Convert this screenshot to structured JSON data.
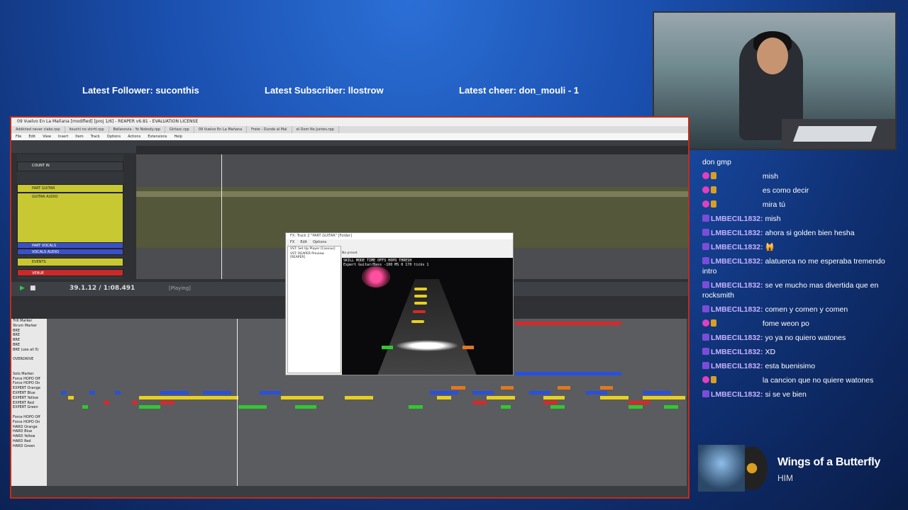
{
  "overlay": {
    "latest_follower": "Latest Follower: suconthis",
    "latest_subscriber": "Latest Subscriber: llostrow",
    "latest_cheer": "Latest cheer: don_mouli - 1"
  },
  "chat": [
    {
      "user": "",
      "message": "don gmp",
      "badges": []
    },
    {
      "user": "",
      "message": "mish",
      "badges": [
        "heart",
        "gold"
      ],
      "hidden_user": true
    },
    {
      "user": "",
      "message": "es como decir",
      "badges": [
        "heart",
        "gold"
      ],
      "hidden_user": true
    },
    {
      "user": "",
      "message": "mira tú",
      "badges": [
        "heart",
        "gold"
      ],
      "hidden_user": true
    },
    {
      "user": "LMBECIL1832:",
      "message": "mish",
      "badges": [
        "sub"
      ]
    },
    {
      "user": "LMBECIL1832:",
      "message": "ahora si golden bien hesha",
      "badges": [
        "sub"
      ]
    },
    {
      "user": "LMBECIL1832:",
      "message": "🙀",
      "badges": [
        "sub"
      ]
    },
    {
      "user": "LMBECIL1832:",
      "message": "alatuerca no me esperaba tremendo intro",
      "badges": [
        "sub"
      ]
    },
    {
      "user": "LMBECIL1832:",
      "message": "se ve mucho mas divertida que en rocksmith",
      "badges": [
        "sub"
      ]
    },
    {
      "user": "LMBECIL1832:",
      "message": "comen y comen y comen",
      "badges": [
        "sub"
      ]
    },
    {
      "user": "",
      "message": "fome weon po",
      "badges": [
        "heart",
        "gold"
      ],
      "hidden_user": true
    },
    {
      "user": "LMBECIL1832:",
      "message": "yo ya no quiero watones",
      "badges": [
        "sub"
      ]
    },
    {
      "user": "LMBECIL1832:",
      "message": "XD",
      "badges": [
        "sub"
      ]
    },
    {
      "user": "LMBECIL1832:",
      "message": "esta buenisimo",
      "badges": [
        "sub"
      ]
    },
    {
      "user": "",
      "message": "la cancion que no quiere watones",
      "badges": [
        "heart",
        "gold"
      ],
      "hidden_user": true
    },
    {
      "user": "LMBECIL1832:",
      "message": "si se ve bien",
      "badges": [
        "sub"
      ]
    }
  ],
  "now_playing": {
    "title": "Wings of a Butterfly",
    "artist": "HIM"
  },
  "daw": {
    "window_title": "09 Vuelvo En La Mañana [modified] [proj 1/6] - REAPER v6.81 - EVALUATION LICENSE",
    "tabs": [
      "Addicted never clabs.rpp",
      "itsuchi no shirtt.rpp",
      "Bellanovia - Yo Nobody.rpp",
      "Gtrlasc.rpp",
      "09 Vuelvo En La Mañana",
      "Frete - Dunde al Mal",
      "el Dom No Juntes.rpp"
    ],
    "menu": [
      "File",
      "Edit",
      "View",
      "Insert",
      "Item",
      "Track",
      "Options",
      "Actions",
      "Extensions",
      "Help"
    ],
    "tracks": [
      {
        "name": "COUNT IN",
        "color": "#3a3d41"
      },
      {
        "name": "PART GUITAR",
        "color": "#c8c832"
      },
      {
        "name": "GUITAR AUDIO",
        "color": "#c8c832"
      },
      {
        "name": "PART VOCALS",
        "color": "#3a50c8"
      },
      {
        "name": "VOCALS AUDIO",
        "color": "#3a50c8"
      },
      {
        "name": "EVENTS",
        "color": "#c8c832"
      },
      {
        "name": "VENUE",
        "color": "#c82a2a"
      }
    ],
    "transport_time": "39.1.12 / 1:08.491",
    "transport_state": "[Playing]",
    "piano_labels": [
      "Trill Marker",
      "Strum Marker",
      "BRE",
      "BRE",
      "BRE",
      "BRE",
      "BRE (use all 5)",
      "",
      "OVERDRIVE",
      "",
      "",
      "Solo Marker",
      "Force HOPO Off",
      "Force HOPO On",
      "EXPERT Orange",
      "EXPERT Blue",
      "EXPERT Yellow",
      "EXPERT Red",
      "EXPERT Green",
      "",
      "Force HOPO Off",
      "Force HOPO On",
      "HARD Orange",
      "HARD Blue",
      "HARD Yellow",
      "HARD Red",
      "HARD Green"
    ]
  },
  "popup": {
    "title": "FX: Track 2 \"PART GUITAR\" [Folder]",
    "menu": [
      "FX",
      "Edit",
      "Options"
    ],
    "fx_items": [
      "VST: Set Up Player [Cassius]",
      "VST: REAPER Preview [REAPER]"
    ],
    "preset_label": "No preset",
    "hud_line1": "SKILL   MODE    TIME OFFS HOPO THRESH",
    "hud_line2": "Expert Guitar/Bass -100 MS 0  170 ticks 1",
    "colors": {
      "gem": "#e8d020",
      "sign": "#ff4fa0"
    }
  },
  "colors": {
    "accent_border": "#c82a12",
    "chat_sub_user": "#c8b0ff",
    "note_green": "#30c830",
    "note_red": "#d82828",
    "note_yellow": "#e8d020",
    "note_blue": "#2850e0",
    "note_orange": "#e07820"
  }
}
